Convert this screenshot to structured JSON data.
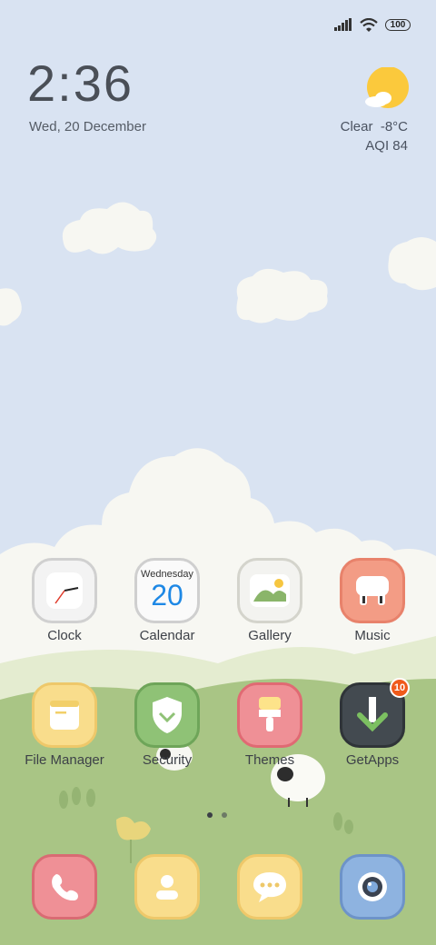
{
  "status_bar": {
    "battery": "100",
    "icons": [
      "signal-icon",
      "wifi-icon",
      "battery-icon"
    ]
  },
  "clock_widget": {
    "time": "2:36",
    "date": "Wed, 20 December"
  },
  "weather_widget": {
    "condition": "Clear",
    "temperature": "-8°C",
    "aqi": "AQI 84",
    "icon": "partly-sunny-icon"
  },
  "apps": {
    "clock": {
      "label": "Clock"
    },
    "calendar": {
      "label": "Calendar",
      "weekday": "Wednesday",
      "day": "20"
    },
    "gallery": {
      "label": "Gallery"
    },
    "music": {
      "label": "Music"
    },
    "file_manager": {
      "label": "File Manager"
    },
    "security": {
      "label": "Security"
    },
    "themes": {
      "label": "Themes"
    },
    "getapps": {
      "label": "GetApps",
      "badge": "10"
    }
  },
  "dock": [
    "phone-icon",
    "contacts-icon",
    "messages-icon",
    "camera-icon"
  ],
  "page_indicator": {
    "pages": 2,
    "current": 1
  },
  "colors": {
    "sky": "#d9e3f2",
    "grass": "#a9c585",
    "badge": "#f05a1a"
  }
}
